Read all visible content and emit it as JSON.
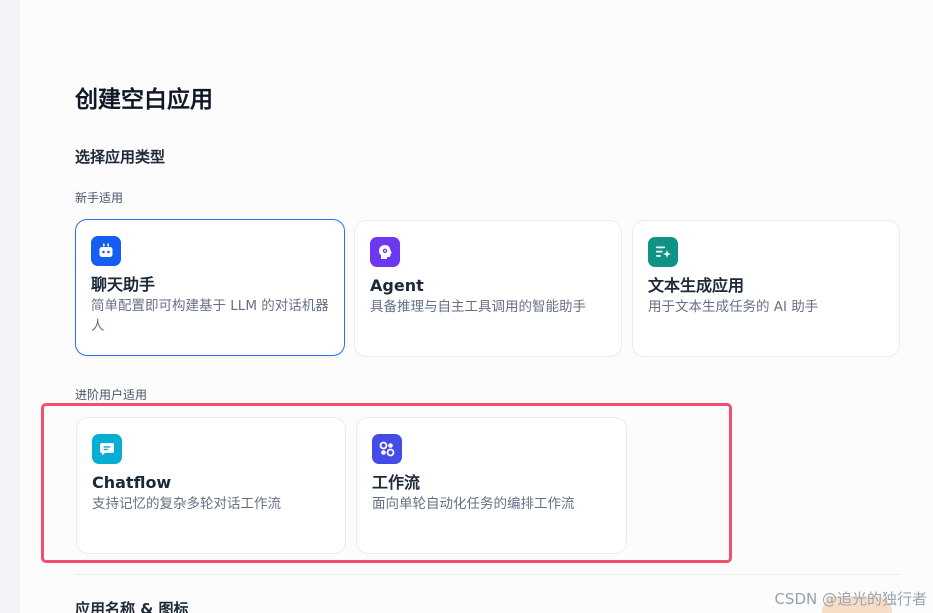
{
  "page": {
    "title": "创建空白应用",
    "section_title": "选择应用类型",
    "bottom_section_title": "应用名称 & 图标"
  },
  "groups": {
    "beginner_label": "新手适用",
    "advanced_label": "进阶用户适用"
  },
  "cards": {
    "chatbot": {
      "title": "聊天助手",
      "desc": "简单配置即可构建基于 LLM 的对话机器人",
      "icon": "robot-icon",
      "color": "#155eef",
      "selected": true
    },
    "agent": {
      "title": "Agent",
      "desc": "具备推理与自主工具调用的智能助手",
      "icon": "agent-brain-icon",
      "color": "#6938ef",
      "selected": false
    },
    "text_gen": {
      "title": "文本生成应用",
      "desc": "用于文本生成任务的 AI 助手",
      "icon": "text-sparkle-icon",
      "color": "#0e9384",
      "selected": false
    },
    "chatflow": {
      "title": "Chatflow",
      "desc": "支持记忆的复杂多轮对话工作流",
      "icon": "chat-bubble-icon",
      "color": "#06aed4",
      "selected": false
    },
    "workflow": {
      "title": "工作流",
      "desc": "面向单轮自动化任务的编排工作流",
      "icon": "workflow-nodes-icon",
      "color": "#444ce7",
      "selected": false
    }
  },
  "annotation": {
    "color": "#f0506e"
  },
  "watermark": {
    "text": "CSDN @追光的独行者"
  }
}
